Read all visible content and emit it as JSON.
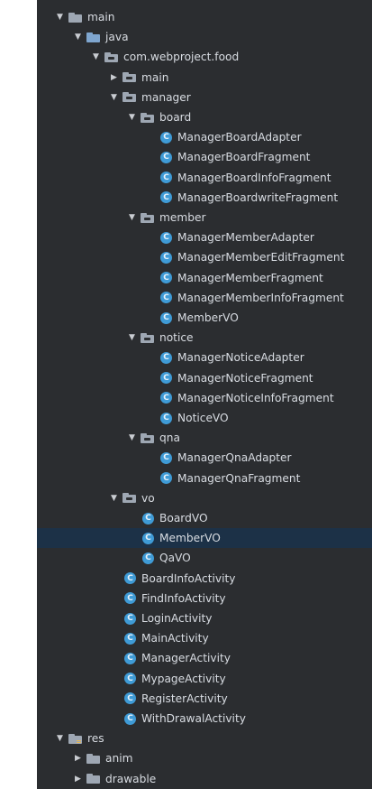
{
  "tree": {
    "rows": [
      {
        "label": "main",
        "type": "folder",
        "depth": 0,
        "expanded": true
      },
      {
        "label": "java",
        "type": "folder-blue",
        "depth": 1,
        "expanded": true
      },
      {
        "label": "com.webproject.food",
        "type": "package",
        "depth": 2,
        "expanded": true
      },
      {
        "label": "main",
        "type": "package",
        "depth": 3,
        "expanded": false
      },
      {
        "label": "manager",
        "type": "package",
        "depth": 3,
        "expanded": true
      },
      {
        "label": "board",
        "type": "package",
        "depth": 4,
        "expanded": true
      },
      {
        "label": "ManagerBoardAdapter",
        "type": "class",
        "depth": 5
      },
      {
        "label": "ManagerBoardFragment",
        "type": "class",
        "depth": 5
      },
      {
        "label": "ManagerBoardInfoFragment",
        "type": "class",
        "depth": 5
      },
      {
        "label": "ManagerBoardwriteFragment",
        "type": "class",
        "depth": 5
      },
      {
        "label": "member",
        "type": "package",
        "depth": 4,
        "expanded": true
      },
      {
        "label": "ManagerMemberAdapter",
        "type": "class",
        "depth": 5
      },
      {
        "label": "ManagerMemberEditFragment",
        "type": "class",
        "depth": 5
      },
      {
        "label": "ManagerMemberFragment",
        "type": "class",
        "depth": 5
      },
      {
        "label": "ManagerMemberInfoFragment",
        "type": "class",
        "depth": 5
      },
      {
        "label": "MemberVO",
        "type": "class",
        "depth": 5
      },
      {
        "label": "notice",
        "type": "package",
        "depth": 4,
        "expanded": true
      },
      {
        "label": "ManagerNoticeAdapter",
        "type": "class",
        "depth": 5
      },
      {
        "label": "ManagerNoticeFragment",
        "type": "class",
        "depth": 5
      },
      {
        "label": "ManagerNoticeInfoFragment",
        "type": "class",
        "depth": 5
      },
      {
        "label": "NoticeVO",
        "type": "class",
        "depth": 5
      },
      {
        "label": "qna",
        "type": "package",
        "depth": 4,
        "expanded": true
      },
      {
        "label": "ManagerQnaAdapter",
        "type": "class",
        "depth": 5
      },
      {
        "label": "ManagerQnaFragment",
        "type": "class",
        "depth": 5
      },
      {
        "label": "vo",
        "type": "package",
        "depth": 3,
        "expanded": true
      },
      {
        "label": "BoardVO",
        "type": "class",
        "depth": 4
      },
      {
        "label": "MemberVO",
        "type": "class",
        "depth": 4,
        "selected": true
      },
      {
        "label": "QaVO",
        "type": "class",
        "depth": 4
      },
      {
        "label": "BoardInfoActivity",
        "type": "class",
        "depth": 3
      },
      {
        "label": "FindInfoActivity",
        "type": "class",
        "depth": 3
      },
      {
        "label": "LoginActivity",
        "type": "class",
        "depth": 3
      },
      {
        "label": "MainActivity",
        "type": "class",
        "depth": 3
      },
      {
        "label": "ManagerActivity",
        "type": "class",
        "depth": 3
      },
      {
        "label": "MypageActivity",
        "type": "class",
        "depth": 3
      },
      {
        "label": "RegisterActivity",
        "type": "class",
        "depth": 3
      },
      {
        "label": "WithDrawalActivity",
        "type": "class",
        "depth": 3
      },
      {
        "label": "res",
        "type": "folder-res",
        "depth": 0,
        "expanded": true
      },
      {
        "label": "anim",
        "type": "folder",
        "depth": 1,
        "expanded": false
      },
      {
        "label": "drawable",
        "type": "folder",
        "depth": 1,
        "expanded": false
      }
    ]
  },
  "icons": {
    "class_letter": "C",
    "expanded_arrow": "▼",
    "collapsed_arrow": "▶"
  },
  "colors": {
    "background": "#2b2d30",
    "selection": "#1c3147",
    "class_icon": "#3f9bd6",
    "folder": "#9ea7b3",
    "source_folder": "#7fa6cf"
  }
}
